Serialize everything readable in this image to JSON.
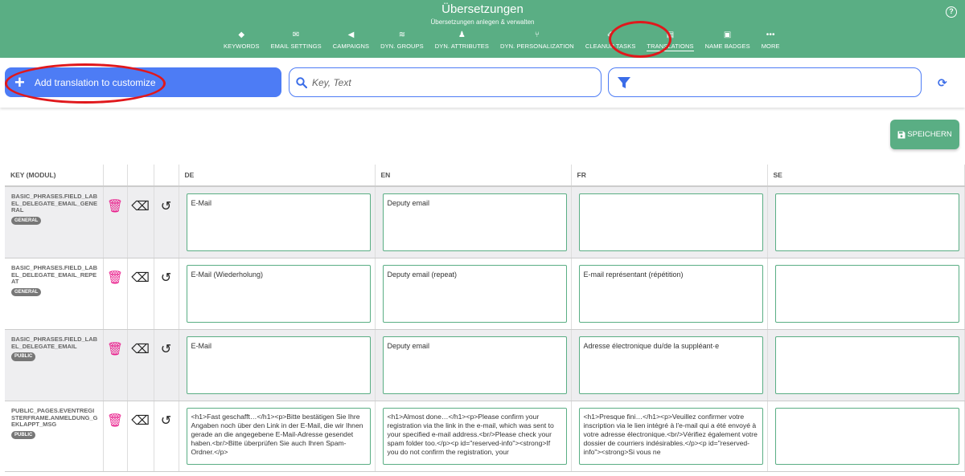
{
  "header": {
    "title": "Übersetzungen",
    "subtitle": "Übersetzungen anlegen & verwalten",
    "help": "?",
    "nav": [
      {
        "label": "KEYWORDS",
        "icon": "tag-icon",
        "glyph": "◆"
      },
      {
        "label": "EMAIL SETTINGS",
        "icon": "envelope-icon",
        "glyph": "✉"
      },
      {
        "label": "CAMPAIGNS",
        "icon": "megaphone-icon",
        "glyph": "◀"
      },
      {
        "label": "DYN. GROUPS",
        "icon": "layers-icon",
        "glyph": "≋"
      },
      {
        "label": "DYN. ATTRIBUTES",
        "icon": "user-tag-icon",
        "glyph": "♟"
      },
      {
        "label": "DYN. PERSONALIZATION",
        "icon": "branch-icon",
        "glyph": "⑂"
      },
      {
        "label": "CLEANUP TASKS",
        "icon": "broom-icon",
        "glyph": "✐"
      },
      {
        "label": "TRANSLATIONS",
        "icon": "language-icon",
        "glyph": "▤"
      },
      {
        "label": "NAME BADGES",
        "icon": "id-card-icon",
        "glyph": "▣"
      },
      {
        "label": "MORE",
        "icon": "more-icon",
        "glyph": "•••"
      }
    ]
  },
  "toolbar": {
    "add_label": "Add translation to customize",
    "search_placeholder": "Key, Text"
  },
  "save_label": "SPEICHERN",
  "table": {
    "columns": [
      "KEY (MODUL)",
      "",
      "",
      "",
      "DE",
      "EN",
      "FR",
      "SE"
    ],
    "rows": [
      {
        "key": "BASIC_PHRASES.FIELD_LABEL_DELEGATE_EMAIL_GENERAL",
        "module": "GENERAL",
        "de": "E-Mail",
        "en": "Deputy email",
        "fr": "",
        "se": ""
      },
      {
        "key": "BASIC_PHRASES.FIELD_LABEL_DELEGATE_EMAIL_REPEAT",
        "module": "GENERAL",
        "de": "E-Mail (Wiederholung)",
        "en": "Deputy email (repeat)",
        "fr": "E-mail représentant (répétition)",
        "se": ""
      },
      {
        "key": "BASIC_PHRASES.FIELD_LABEL_DELEGATE_EMAIL",
        "module": "PUBLIC",
        "de": "E-Mail",
        "en": "Deputy email",
        "fr": "Adresse électronique du/de la suppléant·e",
        "se": ""
      },
      {
        "key": "PUBLIC_PAGES.EVENTREGISTERFRAME.ANMELDUNG_GEKLAPPT_MSG",
        "module": "PUBLIC",
        "de": "<h1>Fast geschafft…</h1><p>Bitte bestätigen Sie Ihre Angaben noch über den Link in der E-Mail, die wir Ihnen gerade an die angegebene E-Mail-Adresse gesendet haben.<br/>Bitte überprüfen Sie auch Ihren Spam-Ordner.</p>",
        "en": "<h1>Almost done…</h1><p>Please confirm your registration via the link in the e-mail, which was sent to your specified e-mail address.<br/>Please check your spam folder too.</p><p id=\"reserved-info\"><strong>If you do not confirm the registration, your",
        "fr": "<h1>Presque fini…</h1><p>Veuillez confirmer votre inscription via le lien intégré à l'e-mail qui a été envoyé à votre adresse électronique.<br/>Vérifiez également votre dossier de courriers indésirables.</p><p id=\"reserved-info\"><strong>Si vous ne",
        "se": ""
      }
    ]
  },
  "colors": {
    "header_green": "#5aae84",
    "primary_blue": "#4d7cf5",
    "trash_pink": "#e91e8c",
    "highlight_red": "#e0181c"
  }
}
